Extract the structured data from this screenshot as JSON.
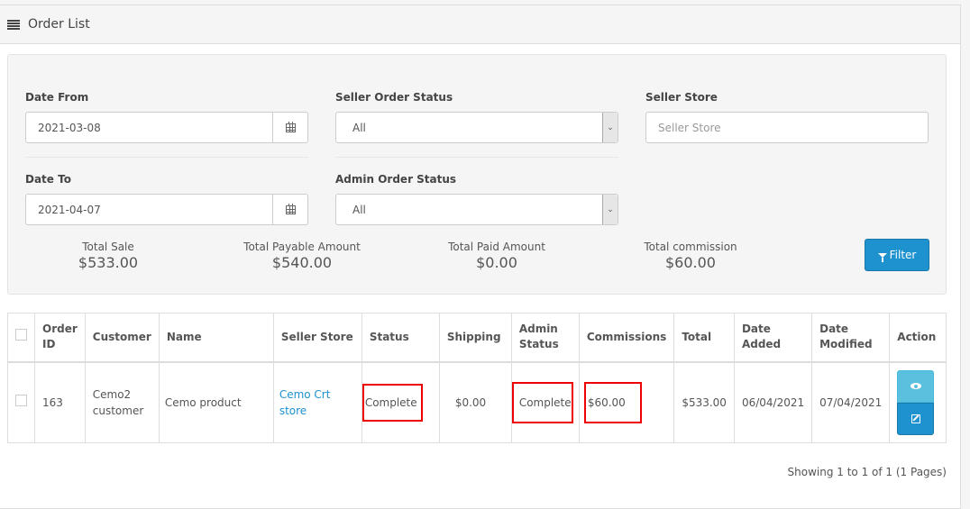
{
  "header": {
    "title": "Order List",
    "icon": "list-icon"
  },
  "filters": {
    "date_from": {
      "label": "Date From",
      "value": "2021-03-08",
      "icon": "calendar-icon"
    },
    "date_to": {
      "label": "Date To",
      "value": "2021-04-07",
      "icon": "calendar-icon"
    },
    "seller_order_status": {
      "label": "Seller Order Status",
      "value": "All"
    },
    "admin_order_status": {
      "label": "Admin Order Status",
      "value": "All"
    },
    "seller_store": {
      "label": "Seller Store",
      "placeholder": "Seller Store",
      "value": ""
    },
    "filter_button": {
      "label": "Filter",
      "icon": "filter-icon",
      "color": "#1e91cf"
    }
  },
  "totals": [
    {
      "label": "Total Sale",
      "value": "$533.00"
    },
    {
      "label": "Total Payable Amount",
      "value": "$540.00"
    },
    {
      "label": "Total Paid Amount",
      "value": "$0.00"
    },
    {
      "label": "Total commission",
      "value": "$60.00"
    }
  ],
  "table": {
    "columns": [
      "",
      "Order ID",
      "Customer",
      "Name",
      "Seller Store",
      "Status",
      "Shipping",
      "Admin Status",
      "Commissions",
      "Total",
      "Date Added",
      "Date Modified",
      "Action"
    ],
    "rows": [
      {
        "order_id": "163",
        "customer": "Cemo2 customer",
        "name": "Cemo product",
        "seller_store": "Cemo Crt store",
        "status": "Complete",
        "shipping": "$0.00",
        "admin_status": "Complete",
        "commissions": "$60.00",
        "total": "$533.00",
        "date_added": "06/04/2021",
        "date_modified": "07/04/2021",
        "actions": [
          "view",
          "edit"
        ]
      }
    ]
  },
  "pagination": {
    "text": "Showing 1 to 1 of 1 (1 Pages)"
  },
  "colors": {
    "primary": "#1e91cf",
    "info": "#5bc0de",
    "highlight": "#ee0000"
  }
}
